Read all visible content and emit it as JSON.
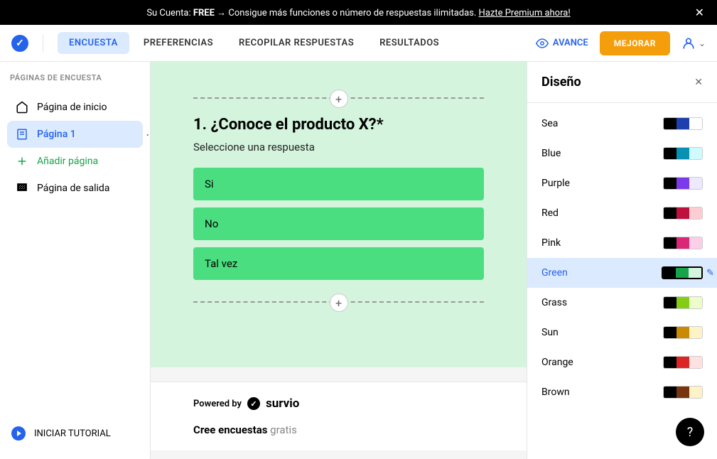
{
  "banner": {
    "prefix": "Su Cuenta: ",
    "plan": "FREE",
    "middle": " → Consigue más funciones o número de respuestas ilimitadas. ",
    "cta": "Hazte Premium ahora!"
  },
  "nav": {
    "tabs": [
      "ENCUESTA",
      "PREFERENCIAS",
      "RECOPILAR RESPUESTAS",
      "RESULTADOS"
    ],
    "avance": "AVANCE",
    "mejorar": "MEJORAR"
  },
  "sidebar": {
    "title": "PÁGINAS DE ENCUESTA",
    "items": {
      "home": "Página de inicio",
      "page1": "Página 1",
      "add": "Añadir página",
      "exit": "Página de salida"
    },
    "tutorial": "INICIAR TUTORIAL"
  },
  "question": {
    "title": "1. ¿Conoce el producto X?*",
    "subtitle": "Seleccione una respuesta",
    "options": [
      "Si",
      "No",
      "Tal vez"
    ]
  },
  "footer": {
    "powered": "Powered by",
    "brand": "survio",
    "cree": "Cree encuestas",
    "gratis": " gratis"
  },
  "design": {
    "title": "Diseño",
    "themes": [
      {
        "name": "Sea",
        "colors": [
          "#000000",
          "#1e40af",
          "#ffffff"
        ],
        "active": false
      },
      {
        "name": "Blue",
        "colors": [
          "#000000",
          "#0891b2",
          "#cffafe"
        ],
        "active": false
      },
      {
        "name": "Purple",
        "colors": [
          "#000000",
          "#7c3aed",
          "#ede9fe"
        ],
        "active": false
      },
      {
        "name": "Red",
        "colors": [
          "#000000",
          "#be123c",
          "#fecdd3"
        ],
        "active": false
      },
      {
        "name": "Pink",
        "colors": [
          "#000000",
          "#db2777",
          "#fbcfe8"
        ],
        "active": false
      },
      {
        "name": "Green",
        "colors": [
          "#000000",
          "#16a34a",
          "#d4f4dd"
        ],
        "active": true
      },
      {
        "name": "Grass",
        "colors": [
          "#000000",
          "#84cc16",
          "#ecfccb"
        ],
        "active": false
      },
      {
        "name": "Sun",
        "colors": [
          "#000000",
          "#ca8a04",
          "#fef3c7"
        ],
        "active": false
      },
      {
        "name": "Orange",
        "colors": [
          "#000000",
          "#dc2626",
          "#fee2e2"
        ],
        "active": false
      },
      {
        "name": "Brown",
        "colors": [
          "#000000",
          "#78350f",
          "#fef3c7"
        ],
        "active": false
      }
    ]
  },
  "help": "?"
}
